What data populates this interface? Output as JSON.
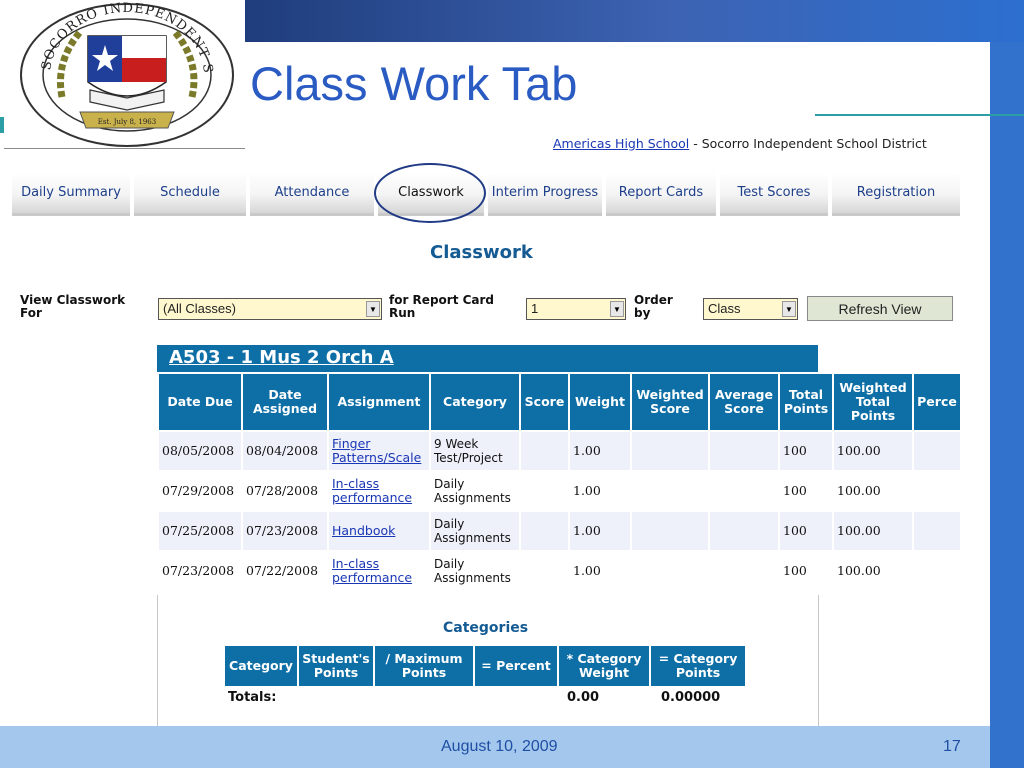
{
  "slide": {
    "title": "Class Work Tab",
    "date": "August 10, 2009",
    "page_number": "17"
  },
  "logo": {
    "ring_text": "SOCORRO INDEPENDENT SCHOOL DISTRICT",
    "banner_text": "Est. July 8, 1963"
  },
  "school": {
    "link": "Americas High School",
    "suffix": " - Socorro Independent School District"
  },
  "tabs": [
    {
      "label": "Daily Summary"
    },
    {
      "label": "Schedule"
    },
    {
      "label": "Attendance"
    },
    {
      "label": "Classwork",
      "active": true
    },
    {
      "label": "Interim Progress"
    },
    {
      "label": "Report Cards"
    },
    {
      "label": "Test Scores"
    },
    {
      "label": "Registration"
    }
  ],
  "page_heading": "Classwork",
  "filters": {
    "view_label": "View Classwork For",
    "view_value": "(All Classes)",
    "run_label": "for Report Card Run",
    "run_value": "1",
    "order_label": "Order by",
    "order_value": "Class",
    "refresh_label": "Refresh View"
  },
  "class": {
    "name": "A503 - 1 Mus 2 Orch A"
  },
  "table": {
    "headers": [
      "Date Due",
      "Date Assigned",
      "Assignment",
      "Category",
      "Score",
      "Weight",
      "Weighted Score",
      "Average Score",
      "Total Points",
      "Weighted Total Points",
      "Perce"
    ],
    "rows": [
      {
        "due": "08/05/2008",
        "assigned": "08/04/2008",
        "assignment": "Finger Patterns/Scale",
        "category": "9 Week Test/Project",
        "score": "",
        "weight": "1.00",
        "weighted_score": "",
        "average_score": "",
        "total_points": "100",
        "weighted_total_points": "100.00",
        "percent": ""
      },
      {
        "due": "07/29/2008",
        "assigned": "07/28/2008",
        "assignment": "In-class performance",
        "category": "Daily Assignments",
        "score": "",
        "weight": "1.00",
        "weighted_score": "",
        "average_score": "",
        "total_points": "100",
        "weighted_total_points": "100.00",
        "percent": ""
      },
      {
        "due": "07/25/2008",
        "assigned": "07/23/2008",
        "assignment": "Handbook",
        "category": "Daily Assignments",
        "score": "",
        "weight": "1.00",
        "weighted_score": "",
        "average_score": "",
        "total_points": "100",
        "weighted_total_points": "100.00",
        "percent": ""
      },
      {
        "due": "07/23/2008",
        "assigned": "07/22/2008",
        "assignment": "In-class performance",
        "category": "Daily Assignments",
        "score": "",
        "weight": "1.00",
        "weighted_score": "",
        "average_score": "",
        "total_points": "100",
        "weighted_total_points": "100.00",
        "percent": ""
      }
    ]
  },
  "categories": {
    "heading": "Categories",
    "headers": [
      "Category",
      "Student's Points",
      "/ Maximum Points",
      "= Percent",
      "* Category Weight",
      "= Category Points"
    ],
    "totals_label": "Totals:",
    "total_weight": "0.00",
    "total_points": "0.00000"
  },
  "colors": {
    "header_blue": "#0e6fa6",
    "title_blue": "#2a5bc2",
    "link_blue": "#1a37b5",
    "select_bg": "#fff8cf",
    "row_alt": "#eef0fa"
  }
}
